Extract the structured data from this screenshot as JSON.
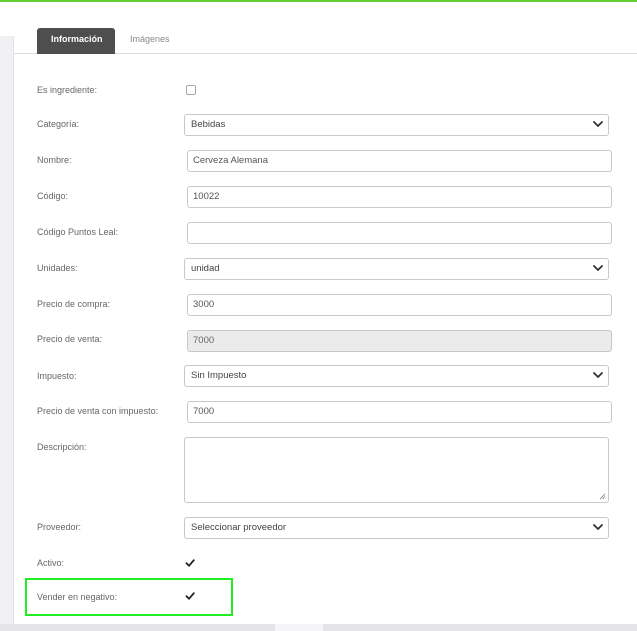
{
  "tabs": [
    {
      "label": "Información",
      "active": true
    },
    {
      "label": "Imágenes",
      "active": false
    }
  ],
  "form": {
    "es_ingrediente": {
      "label": "Es ingrediente:",
      "checked": false
    },
    "categoria": {
      "label": "Categoría:",
      "value": "Bebidas"
    },
    "nombre": {
      "label": "Nombre:",
      "value": "Cerveza Alemana"
    },
    "codigo": {
      "label": "Código:",
      "value": "10022"
    },
    "codigo_puntos": {
      "label": "Código Puntos Leal:",
      "value": ""
    },
    "unidades": {
      "label": "Unidades:",
      "value": "unidad"
    },
    "precio_compra": {
      "label": "Precio de compra:",
      "value": "3000"
    },
    "precio_venta": {
      "label": "Precio de venta:",
      "value": "7000"
    },
    "impuesto": {
      "label": "Impuesto:",
      "value": "Sin Impuesto"
    },
    "precio_venta_impuesto": {
      "label": "Precio de venta con impuesto:",
      "value": "7000"
    },
    "descripcion": {
      "label": "Descripción:",
      "value": ""
    },
    "proveedor": {
      "label": "Proveedor:",
      "value": "Seleccionar proveedor"
    },
    "activo": {
      "label": "Activo:",
      "checked": true
    },
    "vender_negativo": {
      "label": "Vender en negativo:",
      "checked": true
    }
  },
  "colors": {
    "top_accent": "#66cc33",
    "highlight": "#22ee22",
    "active_tab": "#4e4e4e"
  },
  "icons": [
    "chevron-down-icon",
    "checkmark-icon",
    "resize-handle-icon"
  ]
}
